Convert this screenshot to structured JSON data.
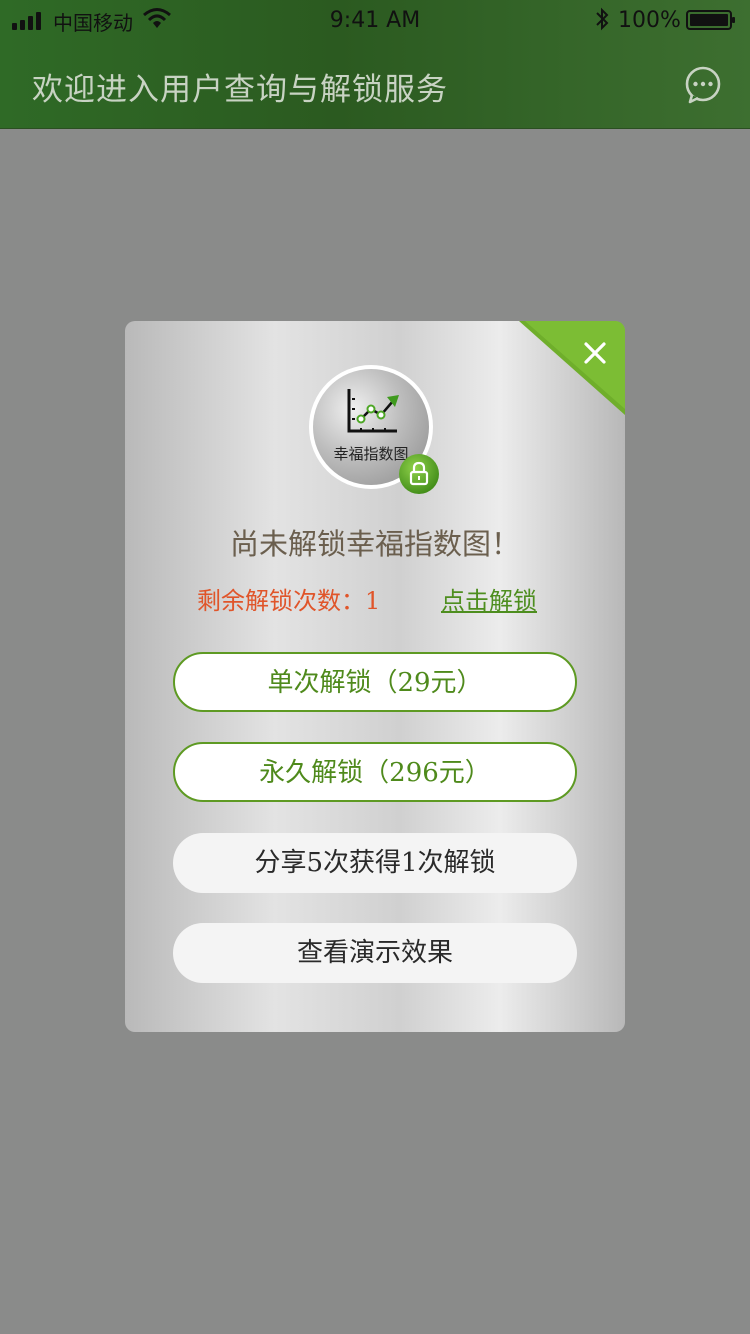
{
  "status_bar": {
    "carrier": "中国移动",
    "time": "9:41 AM",
    "battery": "100%"
  },
  "header": {
    "title": "欢迎进入用户查询与解锁服务"
  },
  "modal": {
    "emblem_label": "幸福指数图",
    "title": "尚未解锁幸福指数图！",
    "remaining": "剩余解锁次数：1",
    "unlock_link": "点击解锁",
    "buttons": {
      "single": "单次解锁（29元）",
      "permanent": "永久解锁（296元）",
      "share": "分享5次获得1次解锁",
      "demo": "查看演示效果"
    }
  },
  "colors": {
    "header_green": "#2f6a26",
    "accent_green": "#5e9a23",
    "remain_orange": "#e0552a",
    "overlay_gray": "#8a8b8a"
  },
  "icons": [
    "signal-icon",
    "wifi-icon",
    "bluetooth-icon",
    "battery-icon",
    "chat-icon",
    "close-icon",
    "chart-icon",
    "lock-icon"
  ]
}
